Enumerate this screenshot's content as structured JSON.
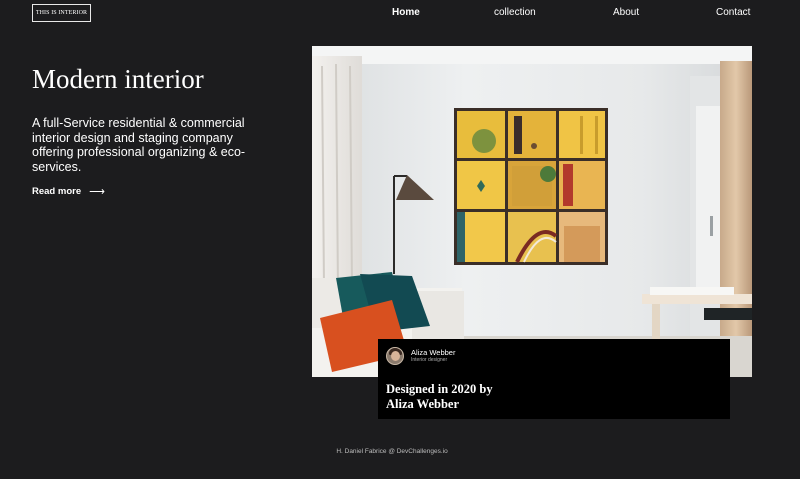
{
  "logo": {
    "text": "THIS IS INTERIOR"
  },
  "nav": {
    "items": [
      "Home",
      "collection",
      "About",
      "Contact"
    ],
    "active": "Home"
  },
  "hero": {
    "title": "Modern interior",
    "description": "A full-Service residential & commercial interior design and staging company offering professional organizing & eco-services.",
    "read_more": "Read more",
    "arrow_icon": "arrow-right-icon"
  },
  "card": {
    "author_name": "Aliza Webber",
    "author_role": "Interior designer",
    "caption_line1": "Designed in 2020 by",
    "caption_line2": "Aliza Webber"
  },
  "footer": {
    "credit": "H. Daniel Fabrice @ DevChallenges.io"
  },
  "colors": {
    "background": "#1c1c1e",
    "card": "#000000",
    "text": "#ffffff",
    "muted": "#bdbdbd"
  }
}
